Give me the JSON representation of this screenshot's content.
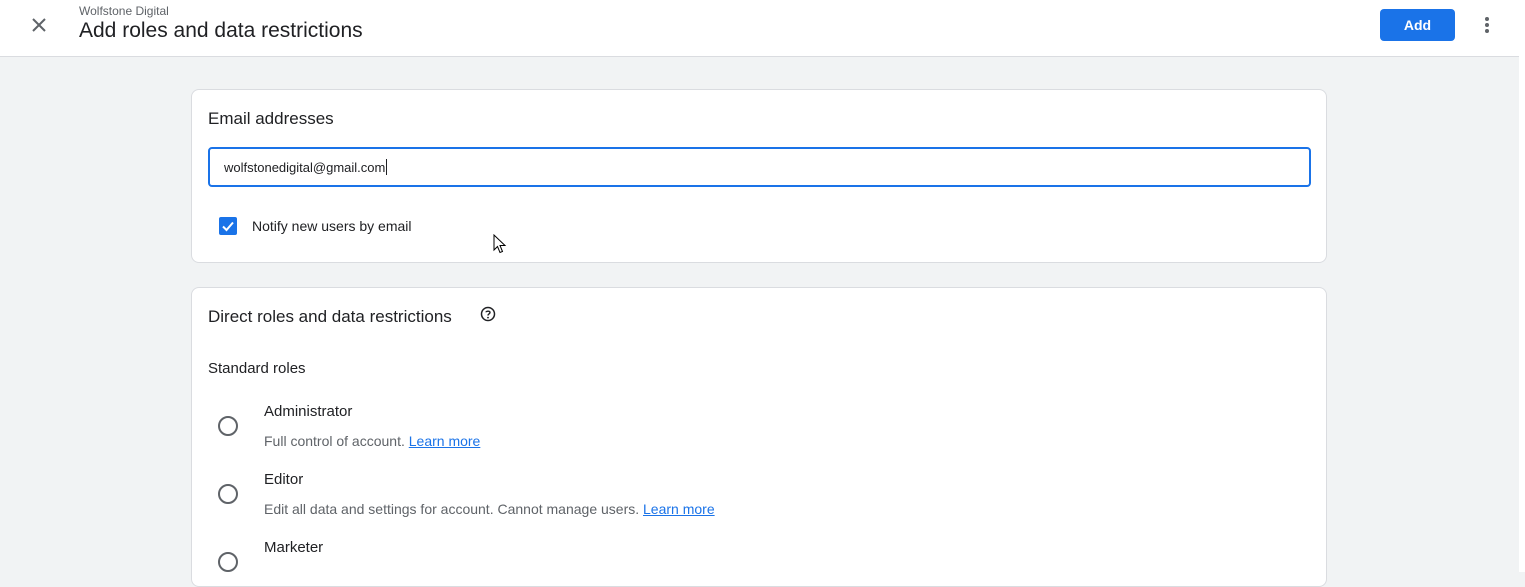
{
  "header": {
    "account_name": "Wolfstone Digital",
    "title": "Add roles and data restrictions",
    "add_label": "Add",
    "close_icon": "close-icon",
    "more_icon": "more-vert-icon"
  },
  "email_card": {
    "title": "Email addresses",
    "email_value": "wolfstonedigital@gmail.com",
    "notify_label": "Notify new users by email",
    "notify_checked": true
  },
  "roles_card": {
    "title": "Direct roles and data restrictions",
    "help_icon": "help-icon",
    "standard_roles_label": "Standard roles",
    "roles": [
      {
        "name": "Administrator",
        "description": "Full control of account.",
        "link": "Learn more",
        "selected": false
      },
      {
        "name": "Editor",
        "description": "Edit all data and settings for account. Cannot manage users.",
        "link": "Learn more",
        "selected": false
      },
      {
        "name": "Marketer",
        "description": "",
        "link": "",
        "selected": false
      }
    ]
  },
  "colors": {
    "accent": "#1a73e8",
    "background": "#f1f3f4",
    "text_primary": "#202124",
    "text_secondary": "#5f6368"
  }
}
